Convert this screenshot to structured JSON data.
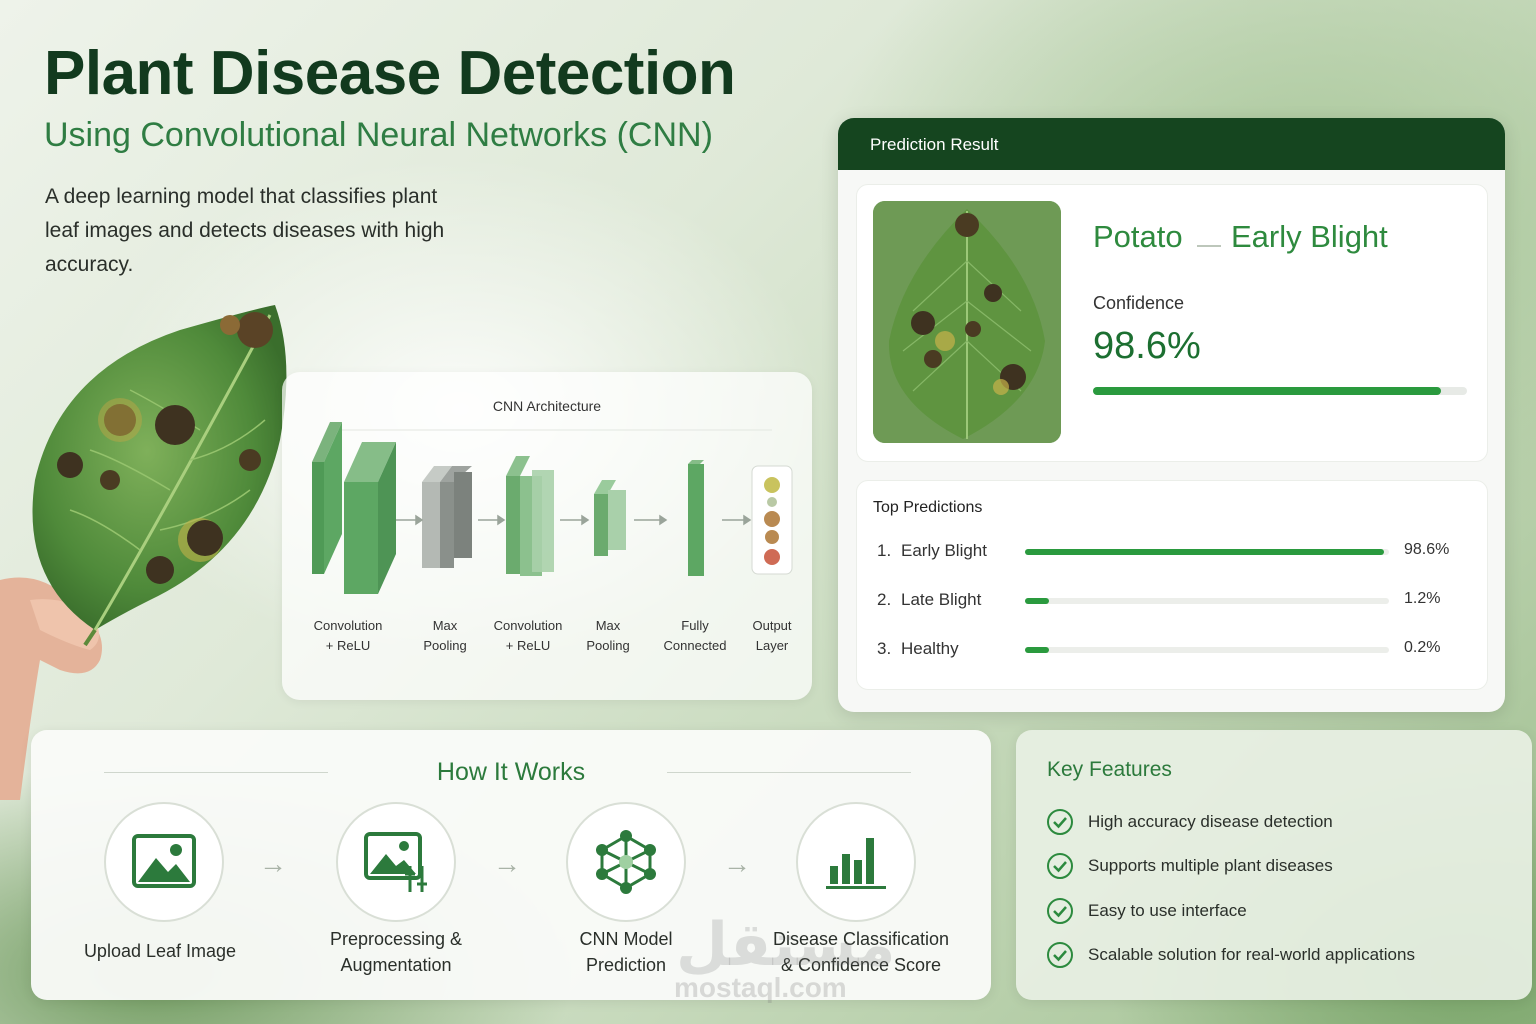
{
  "header": {
    "title": "Plant Disease Detection",
    "subtitle": "Using Convolutional Neural Networks (CNN)",
    "description": "A deep learning model that classifies plant leaf images and detects diseases with high accuracy."
  },
  "cnn": {
    "title": "CNN Architecture",
    "layers": [
      {
        "line1": "Convolution",
        "line2": "+ ReLU"
      },
      {
        "line1": "Max",
        "line2": "Pooling"
      },
      {
        "line1": "Convolution",
        "line2": "+ ReLU"
      },
      {
        "line1": "Max",
        "line2": "Pooling"
      },
      {
        "line1": "Fully",
        "line2": "Connected"
      },
      {
        "line1": "Output",
        "line2": "Layer"
      }
    ]
  },
  "prediction": {
    "header": "Prediction Result",
    "plant": "Potato",
    "disease": "Early Blight",
    "confidence_label": "Confidence",
    "confidence_value": "98.6%",
    "confidence_fraction": 0.93,
    "top_title": "Top Predictions",
    "top": [
      {
        "rank": "1.",
        "name": "Early Blight",
        "pct": "98.6%",
        "fraction": 0.986
      },
      {
        "rank": "2.",
        "name": "Late Blight",
        "pct": "1.2%",
        "fraction": 0.066
      },
      {
        "rank": "3.",
        "name": "Healthy",
        "pct": "0.2%",
        "fraction": 0.066
      }
    ]
  },
  "how": {
    "title": "How It Works",
    "steps": [
      {
        "line1": "Upload Leaf Image",
        "line2": "",
        "icon": "image-icon"
      },
      {
        "line1": "Preprocessing &",
        "line2": "Augmentation",
        "icon": "image-adjust-icon"
      },
      {
        "line1": "CNN Model",
        "line2": "Prediction",
        "icon": "network-icon"
      },
      {
        "line1": "Disease Classification",
        "line2": "& Confidence Score",
        "icon": "bar-chart-icon"
      }
    ]
  },
  "features": {
    "title": "Key Features",
    "items": [
      "High accuracy disease detection",
      "Supports multiple plant diseases",
      "Easy to use interface",
      "Scalable solution for real-world applications"
    ]
  },
  "watermark": {
    "arabic": "مستقل",
    "latin": "mostaql.com"
  },
  "colors": {
    "primary": "#2e8a3e",
    "header_dark": "#15451f",
    "title": "#123a1e"
  }
}
